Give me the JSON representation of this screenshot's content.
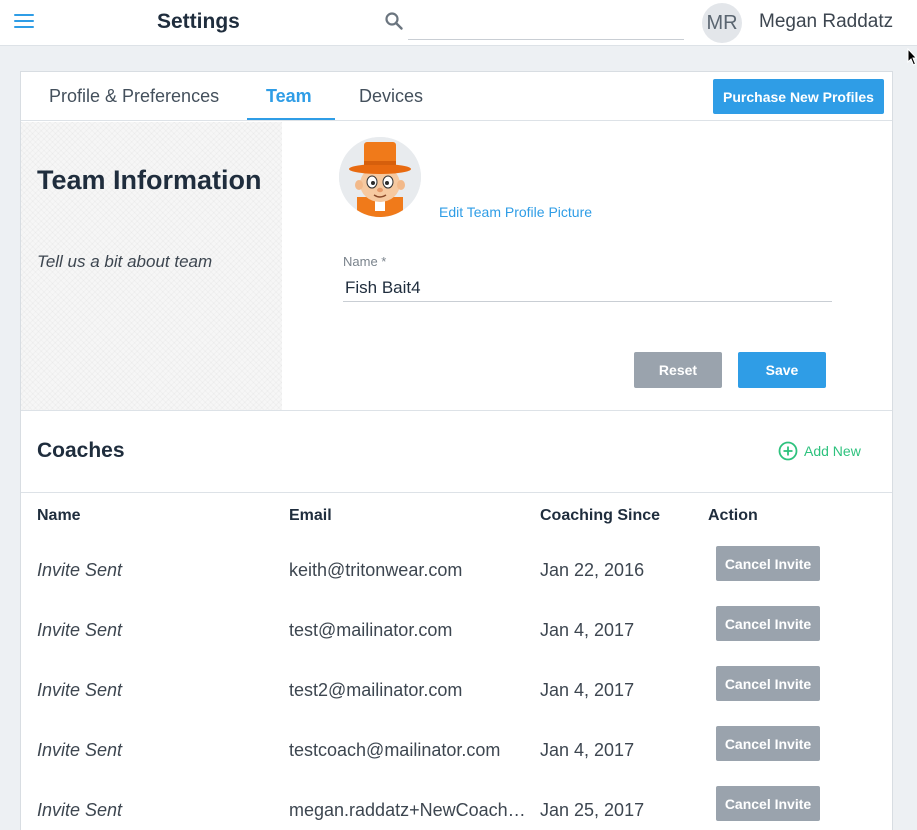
{
  "header": {
    "title": "Settings",
    "search_placeholder": "",
    "user_initials": "MR",
    "user_name": "Megan Raddatz"
  },
  "tabs": [
    {
      "label": "Profile & Preferences",
      "active": false
    },
    {
      "label": "Team",
      "active": true
    },
    {
      "label": "Devices",
      "active": false
    }
  ],
  "purchase_label": "Purchase New Profiles",
  "team_info": {
    "title": "Team Information",
    "subtitle": "Tell us a bit about team",
    "edit_picture_label": "Edit Team Profile Picture",
    "name_label": "Name *",
    "name_value": "Fish Bait4",
    "reset_label": "Reset",
    "save_label": "Save"
  },
  "coaches": {
    "title": "Coaches",
    "add_new_label": "Add New",
    "columns": [
      "Name",
      "Email",
      "Coaching Since",
      "Action"
    ],
    "rows": [
      {
        "name": "Invite Sent",
        "email": "keith@tritonwear.com",
        "since": "Jan 22, 2016",
        "action": "Cancel Invite"
      },
      {
        "name": "Invite Sent",
        "email": "test@mailinator.com",
        "since": "Jan 4, 2017",
        "action": "Cancel Invite"
      },
      {
        "name": "Invite Sent",
        "email": "test2@mailinator.com",
        "since": "Jan 4, 2017",
        "action": "Cancel Invite"
      },
      {
        "name": "Invite Sent",
        "email": "testcoach@mailinator.com",
        "since": "Jan 4, 2017",
        "action": "Cancel Invite"
      },
      {
        "name": "Invite Sent",
        "email": "megan.raddatz+NewCoach@...",
        "since": "Jan 25, 2017",
        "action": "Cancel Invite"
      }
    ]
  },
  "colors": {
    "accent": "#2f9de6",
    "add_new": "#2ec27e",
    "muted_button": "#9aa3ad"
  }
}
